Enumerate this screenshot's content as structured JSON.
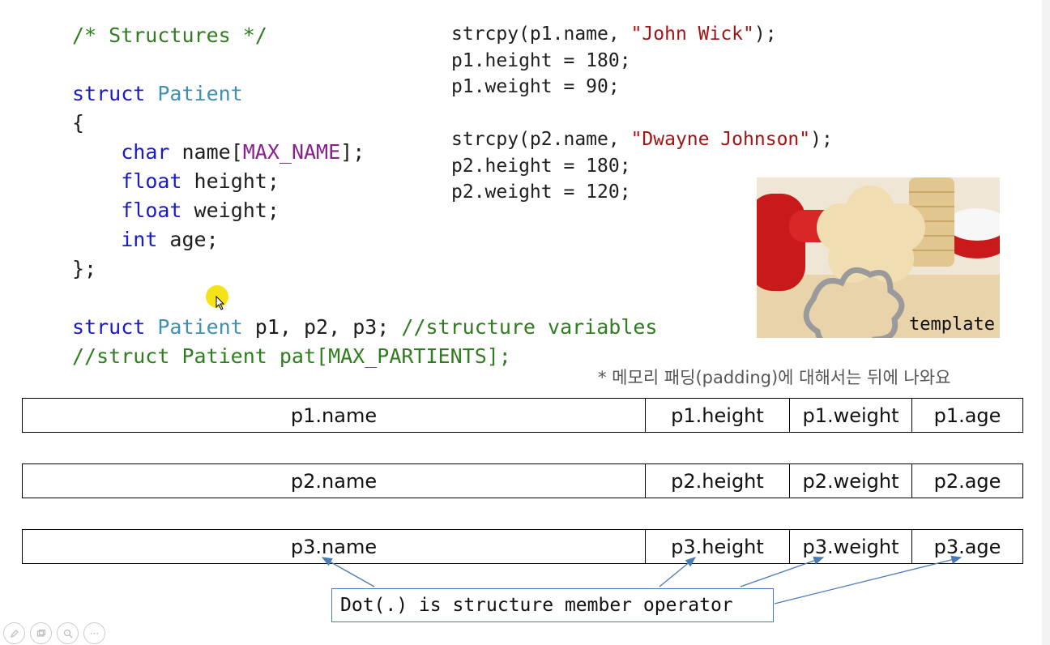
{
  "code_left": {
    "comment_structures": "/* Structures */",
    "kw_struct": "struct",
    "type_patient": "Patient",
    "brace_open": "{",
    "kw_char": "char",
    "name_decl": " name[",
    "macro_max_name": "MAX_NAME",
    "name_decl_end": "];",
    "kw_float": "float",
    "height_decl": " height;",
    "weight_decl": " weight;",
    "kw_int": "int",
    "age_decl": " age;",
    "brace_close": "};",
    "vars_decl": " p1, p2, p3; ",
    "vars_comment": "//structure variables",
    "array_comment": "//struct Patient pat[MAX_PARTIENTS];"
  },
  "code_right": {
    "line1_a": "strcpy(p1.name, ",
    "line1_str": "\"John Wick\"",
    "line1_b": ");",
    "line2": "p1.height = 180;",
    "line3": "p1.weight = 90;",
    "line4_a": "strcpy(p2.name, ",
    "line4_str": "\"Dwayne Johnson\"",
    "line4_b": ");",
    "line5": "p2.height = 180;",
    "line6": "p2.weight = 120;"
  },
  "photo": {
    "caption": "template",
    "description_icon": "cookie-cutter-photo"
  },
  "padding_note": "* 메모리 패딩(padding)에 대해서는 뒤에 나와요",
  "memory_rows": [
    {
      "name": "p1.name",
      "height": "p1.height",
      "weight": "p1.weight",
      "age": "p1.age"
    },
    {
      "name": "p2.name",
      "height": "p2.height",
      "weight": "p2.weight",
      "age": "p2.age"
    },
    {
      "name": "p3.name",
      "height": "p3.height",
      "weight": "p3.weight",
      "age": "p3.age"
    }
  ],
  "callout": "Dot(.) is structure member operator",
  "toolbar": {
    "pen_icon": "pen-icon",
    "copy_icon": "slides-icon",
    "zoom_icon": "zoom-icon",
    "more_icon": "more-icon",
    "more_label": "···"
  },
  "colors": {
    "keyword": "#1a1ac6",
    "type": "#3f8fb5",
    "macro": "#8a1f8f",
    "comment": "#2f7d1f",
    "string": "#a31515",
    "arrow": "#4a7bb5"
  }
}
